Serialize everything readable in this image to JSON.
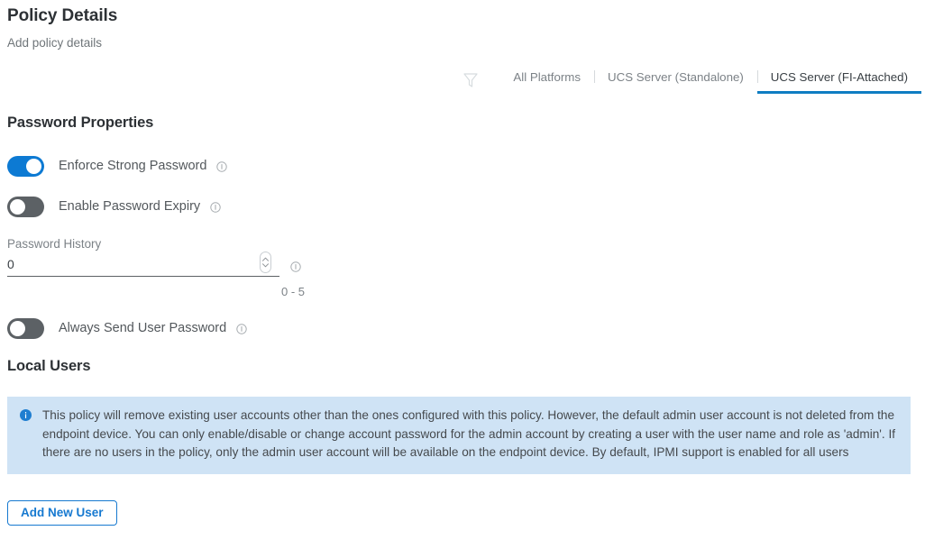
{
  "header": {
    "title": "Policy Details",
    "subtitle": "Add policy details"
  },
  "platform_filter": {
    "filter_icon": "funnel-icon",
    "tabs": [
      {
        "label": "All Platforms",
        "active": false
      },
      {
        "label": "UCS Server (Standalone)",
        "active": false
      },
      {
        "label": "UCS Server (FI-Attached)",
        "active": true
      }
    ],
    "active_color": "#0f7dc2"
  },
  "password_properties": {
    "section_title": "Password Properties",
    "toggles": [
      {
        "label": "Enforce Strong Password",
        "state": "on",
        "info_icon": "info-circle-icon",
        "on_color": "#0d7ad3"
      },
      {
        "label": "Enable Password Expiry",
        "state": "off",
        "info_icon": "info-circle-icon",
        "off_color": "#5c6165"
      }
    ],
    "password_history": {
      "label": "Password History",
      "value": "0",
      "placeholder": "0",
      "hint": "0 - 5",
      "info_icon": "info-circle-icon",
      "stepper_icon": "spinner-up-down-icon"
    },
    "always_send_password": {
      "label": "Always Send User Password",
      "state": "off",
      "info_icon": "info-circle-icon"
    }
  },
  "local_users": {
    "section_title": "Local Users",
    "info_banner": {
      "icon": "info-filled-icon",
      "icon_color": "#1f7ed0",
      "background": "#cfe3f5",
      "text": "This policy will remove existing user accounts other than the ones configured with this policy. However, the default admin user account is not deleted from the endpoint device. You can only enable/disable or change account password for the admin account by creating a user with the user name and role as 'admin'. If there are no users in the policy, only the admin user account will be available on the endpoint device. By default, IPMI support is enabled for all users"
    },
    "add_user_button": {
      "label": "Add New User",
      "accent_color": "#1679d0"
    }
  }
}
